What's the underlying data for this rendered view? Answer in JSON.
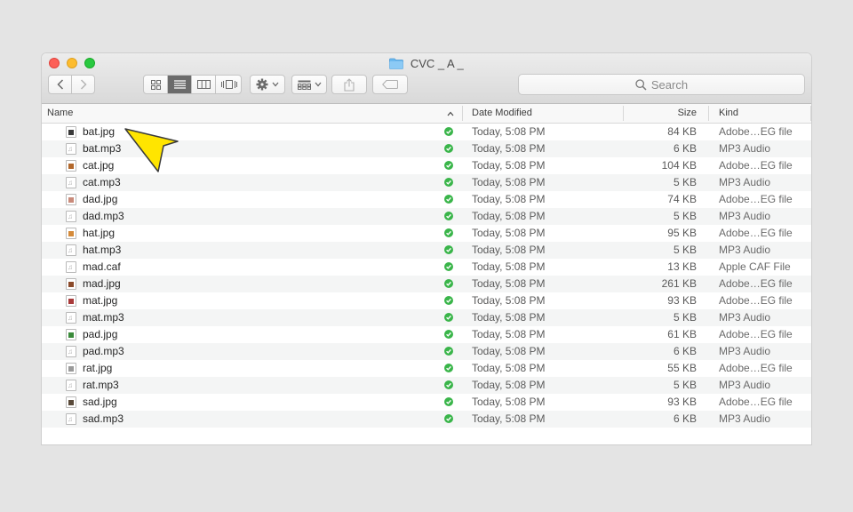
{
  "window": {
    "title": "CVC _ A _"
  },
  "toolbar": {
    "view_modes": [
      "icon-view",
      "list-view",
      "column-view",
      "cover-flow-view"
    ],
    "selected_view": "list-view"
  },
  "search": {
    "placeholder": "Search"
  },
  "columns": {
    "name": "Name",
    "date": "Date Modified",
    "size": "Size",
    "kind": "Kind"
  },
  "files": [
    {
      "name": "bat.jpg",
      "date": "Today, 5:08 PM",
      "size": "84 KB",
      "kind": "Adobe…EG file",
      "icon": "jpg",
      "thumb": "#3a3a3a"
    },
    {
      "name": "bat.mp3",
      "date": "Today, 5:08 PM",
      "size": "6 KB",
      "kind": "MP3 Audio",
      "icon": "mp3"
    },
    {
      "name": "cat.jpg",
      "date": "Today, 5:08 PM",
      "size": "104 KB",
      "kind": "Adobe…EG file",
      "icon": "jpg",
      "thumb": "#b2682c"
    },
    {
      "name": "cat.mp3",
      "date": "Today, 5:08 PM",
      "size": "5 KB",
      "kind": "MP3 Audio",
      "icon": "mp3"
    },
    {
      "name": "dad.jpg",
      "date": "Today, 5:08 PM",
      "size": "74 KB",
      "kind": "Adobe…EG file",
      "icon": "jpg",
      "thumb": "#c98a7a"
    },
    {
      "name": "dad.mp3",
      "date": "Today, 5:08 PM",
      "size": "5 KB",
      "kind": "MP3 Audio",
      "icon": "mp3"
    },
    {
      "name": "hat.jpg",
      "date": "Today, 5:08 PM",
      "size": "95 KB",
      "kind": "Adobe…EG file",
      "icon": "jpg",
      "thumb": "#d48a3a"
    },
    {
      "name": "hat.mp3",
      "date": "Today, 5:08 PM",
      "size": "5 KB",
      "kind": "MP3 Audio",
      "icon": "mp3"
    },
    {
      "name": "mad.caf",
      "date": "Today, 5:08 PM",
      "size": "13 KB",
      "kind": "Apple CAF File",
      "icon": "mp3"
    },
    {
      "name": "mad.jpg",
      "date": "Today, 5:08 PM",
      "size": "261 KB",
      "kind": "Adobe…EG file",
      "icon": "jpg",
      "thumb": "#8a4a2a"
    },
    {
      "name": "mat.jpg",
      "date": "Today, 5:08 PM",
      "size": "93 KB",
      "kind": "Adobe…EG file",
      "icon": "jpg",
      "thumb": "#a83a3a"
    },
    {
      "name": "mat.mp3",
      "date": "Today, 5:08 PM",
      "size": "5 KB",
      "kind": "MP3 Audio",
      "icon": "mp3"
    },
    {
      "name": "pad.jpg",
      "date": "Today, 5:08 PM",
      "size": "61 KB",
      "kind": "Adobe…EG file",
      "icon": "jpg",
      "thumb": "#3a8a3a"
    },
    {
      "name": "pad.mp3",
      "date": "Today, 5:08 PM",
      "size": "6 KB",
      "kind": "MP3 Audio",
      "icon": "mp3"
    },
    {
      "name": "rat.jpg",
      "date": "Today, 5:08 PM",
      "size": "55 KB",
      "kind": "Adobe…EG file",
      "icon": "jpg",
      "thumb": "#9a9a9a"
    },
    {
      "name": "rat.mp3",
      "date": "Today, 5:08 PM",
      "size": "5 KB",
      "kind": "MP3 Audio",
      "icon": "mp3"
    },
    {
      "name": "sad.jpg",
      "date": "Today, 5:08 PM",
      "size": "93 KB",
      "kind": "Adobe…EG file",
      "icon": "jpg",
      "thumb": "#5a4a3a"
    },
    {
      "name": "sad.mp3",
      "date": "Today, 5:08 PM",
      "size": "6 KB",
      "kind": "MP3 Audio",
      "icon": "mp3"
    }
  ],
  "colors": {
    "sync_check": "#3ab54a",
    "pointer": "#ffe500",
    "selected_view_segment": "#6b6b6b"
  }
}
